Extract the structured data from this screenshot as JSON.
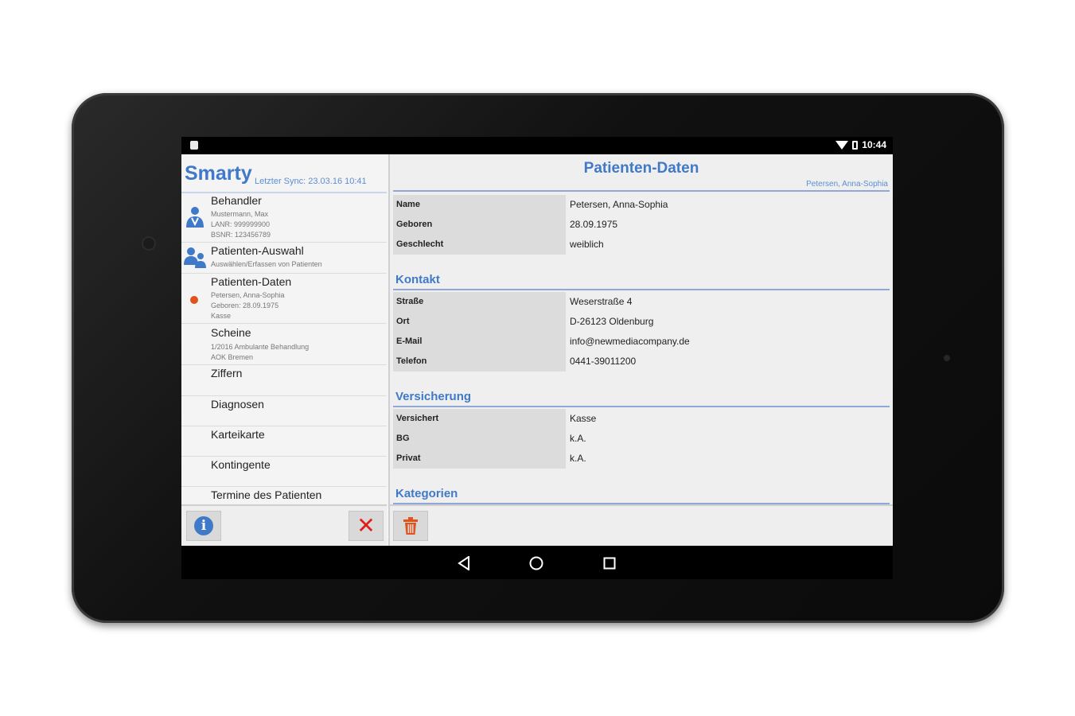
{
  "status": {
    "time": "10:44"
  },
  "app": {
    "brand": "Smarty",
    "sync": "Letzter Sync: 23.03.16 10:41"
  },
  "nav": [
    {
      "title": "Behandler",
      "sub": [
        "Mustermann, Max",
        "LANR: 999999900",
        "BSNR: 123456789"
      ],
      "icon": "doctor-icon"
    },
    {
      "title": "Patienten-Auswahl",
      "sub": [
        "Auswählen/Erfassen von Patienten"
      ],
      "icon": "patients-icon"
    },
    {
      "title": "Patienten-Daten",
      "sub": [
        "Petersen, Anna-Sophia",
        "Geboren: 28.09.1975",
        "Kasse"
      ],
      "icon": "active-dot"
    },
    {
      "title": "Scheine",
      "sub": [
        "1/2016 Ambulante Behandlung",
        "AOK Bremen"
      ]
    },
    {
      "title": "Ziffern",
      "sub": []
    },
    {
      "title": "Diagnosen",
      "sub": []
    },
    {
      "title": "Karteikarte",
      "sub": []
    },
    {
      "title": "Kontingente",
      "sub": []
    },
    {
      "title": "Termine des Patienten",
      "sub": []
    }
  ],
  "main": {
    "title": "Patienten-Daten",
    "subtitle": "Petersen, Anna-Sophia",
    "personal": [
      {
        "label": "Name",
        "value": "Petersen, Anna-Sophia"
      },
      {
        "label": "Geboren",
        "value": "28.09.1975"
      },
      {
        "label": "Geschlecht",
        "value": "weiblich"
      }
    ],
    "kontakt_title": "Kontakt",
    "kontakt": [
      {
        "label": "Straße",
        "value": "Weserstraße 4"
      },
      {
        "label": "Ort",
        "value": "D-26123 Oldenburg"
      },
      {
        "label": "E-Mail",
        "value": "info@newmediacompany.de"
      },
      {
        "label": "Telefon",
        "value": "0441-39011200"
      }
    ],
    "versicherung_title": "Versicherung",
    "versicherung": [
      {
        "label": "Versichert",
        "value": "Kasse"
      },
      {
        "label": "BG",
        "value": "k.A."
      },
      {
        "label": "Privat",
        "value": "k.A."
      }
    ],
    "kategorien_title": "Kategorien"
  },
  "colors": {
    "accent": "#3f79c8",
    "delete": "#e21b1b",
    "active": "#e0531d"
  }
}
